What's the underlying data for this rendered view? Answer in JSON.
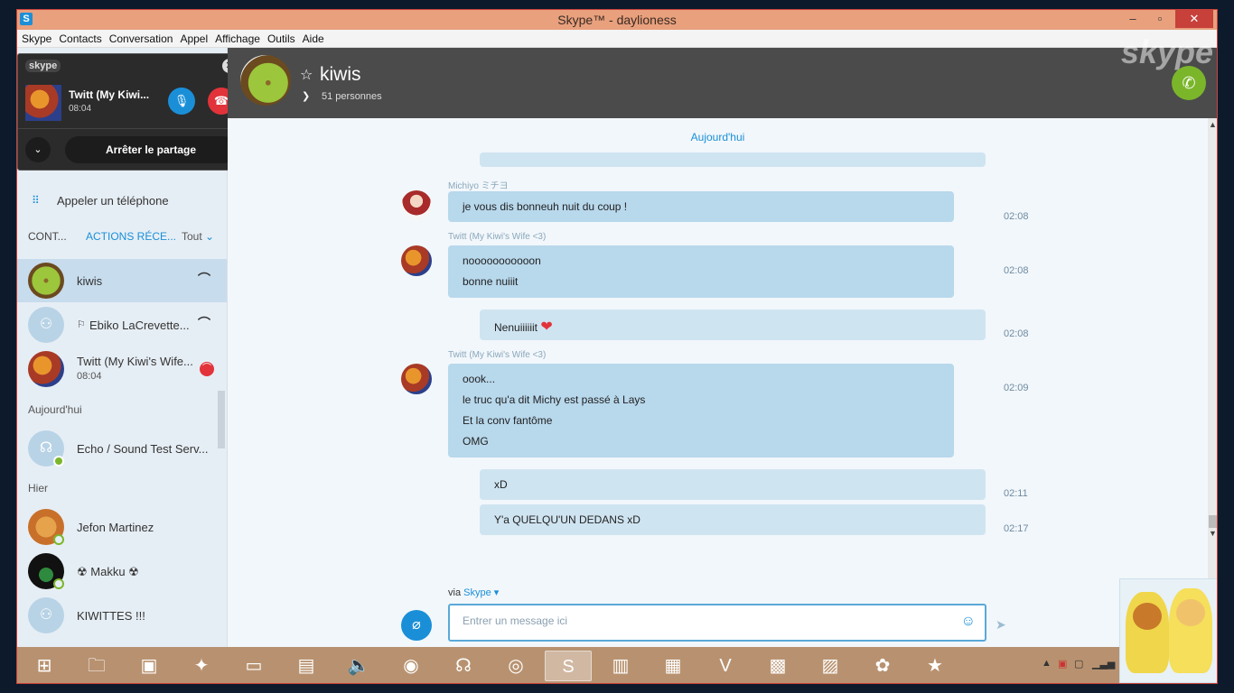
{
  "window": {
    "title": "Skype™ - daylioness",
    "app_icon": "S",
    "controls": {
      "minimize": "–",
      "maximize": "▫",
      "close": "✕"
    }
  },
  "menu": [
    "Skype",
    "Contacts",
    "Conversation",
    "Appel",
    "Affichage",
    "Outils",
    "Aide"
  ],
  "call_overlay": {
    "brand": "skype",
    "caller_name": "Twitt (My Kiwi...",
    "duration": "08:04",
    "stop_label": "Arrêter le partage"
  },
  "sidebar": {
    "call_phone": "Appeler un téléphone",
    "tabs": {
      "contacts": "CONT...",
      "recent": "ACTIONS RÉCE...",
      "filter": "Tout"
    },
    "recent_items": [
      {
        "name": "kiwis"
      },
      {
        "name": "Ebiko LaCrevette..."
      },
      {
        "name": "Twitt (My Kiwi's Wife...",
        "sub": "08:04"
      }
    ],
    "section_today": "Aujourd'hui",
    "today_items": [
      {
        "name": "Echo / Sound Test Serv..."
      }
    ],
    "section_yesterday": "Hier",
    "yesterday_items": [
      {
        "name": "Jefon Martinez"
      },
      {
        "name": "☢ Makku ☢"
      },
      {
        "name": "KIWITTES !!!"
      }
    ]
  },
  "chat_header": {
    "title": "kiwis",
    "members": "51 personnes"
  },
  "chat": {
    "day_label": "Aujourd'hui",
    "messages": [
      {
        "sender": "Michiyo ミチヨ",
        "lines": [
          "je vous dis bonneuh nuit du coup !"
        ],
        "time": "02:08"
      },
      {
        "sender": "Twitt (My Kiwi's Wife <3)",
        "lines": [
          "nooooooooooon",
          "bonne nuiiit"
        ],
        "time": "02:08"
      },
      {
        "sender": "",
        "lines": [
          "Nenuiiiiiit"
        ],
        "time": "02:08"
      },
      {
        "sender": "Twitt (My Kiwi's Wife <3)",
        "lines": [
          "oook...",
          "le truc qu'a dit Michy est passé à Lays",
          "Et la conv fantôme",
          "OMG"
        ],
        "time": "02:09"
      },
      {
        "sender": "",
        "lines": [
          "xD"
        ],
        "time": "02:11"
      },
      {
        "sender": "",
        "lines": [
          "Y'a QUELQU'UN DEDANS xD"
        ],
        "time": "02:17"
      }
    ],
    "via_prefix": "via",
    "via_service": "Skype ▾",
    "input_placeholder": "Entrer un message ici"
  },
  "colors": {
    "accent": "#1a8fd8",
    "bubble": "#b8d8ec",
    "header_bg": "#4b4b4b",
    "call_green": "#7bb62a",
    "hangup_red": "#e2333a",
    "taskbar": "#b89270"
  }
}
